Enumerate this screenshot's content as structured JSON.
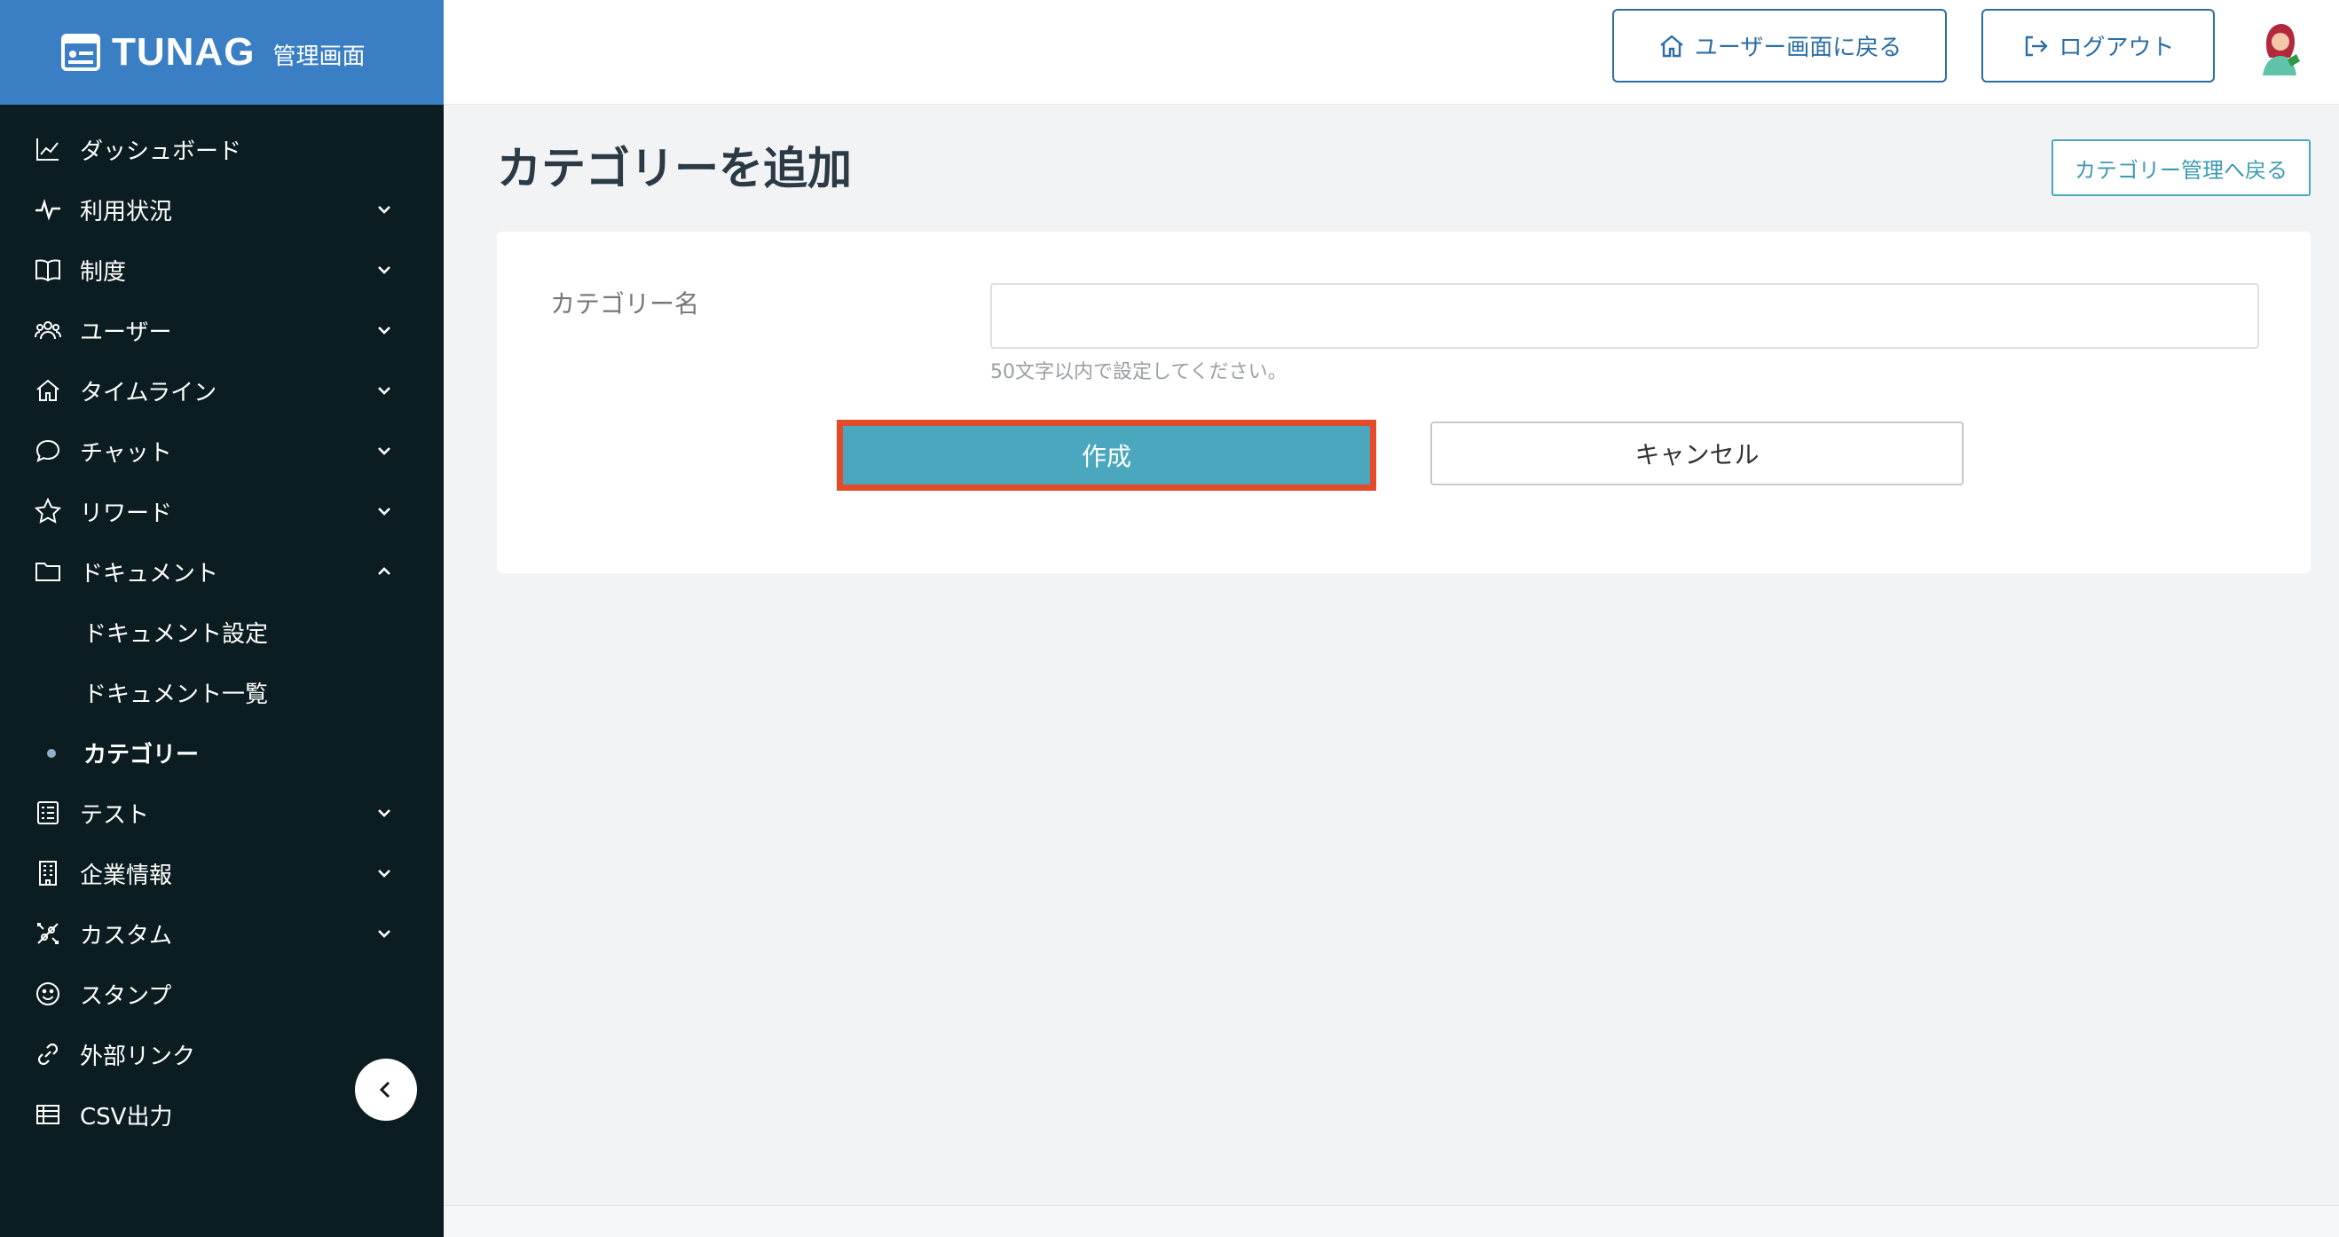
{
  "brand": {
    "name": "TUNAG",
    "sub": "管理画面"
  },
  "header": {
    "user_screen_label": "ユーザー画面に戻る",
    "logout_label": "ログアウト"
  },
  "sidebar": {
    "items": [
      {
        "label": "ダッシュボード",
        "icon": "chart-line-icon",
        "expandable": false
      },
      {
        "label": "利用状況",
        "icon": "activity-icon",
        "expandable": true
      },
      {
        "label": "制度",
        "icon": "book-icon",
        "expandable": true
      },
      {
        "label": "ユーザー",
        "icon": "users-icon",
        "expandable": true
      },
      {
        "label": "タイムライン",
        "icon": "home-icon",
        "expandable": true
      },
      {
        "label": "チャット",
        "icon": "chat-bubble-icon",
        "expandable": true
      },
      {
        "label": "リワード",
        "icon": "star-icon",
        "expandable": true
      },
      {
        "label": "ドキュメント",
        "icon": "folder-icon",
        "expandable": true,
        "expanded": true
      },
      {
        "label": "テスト",
        "icon": "checklist-icon",
        "expandable": true
      },
      {
        "label": "企業情報",
        "icon": "building-icon",
        "expandable": true
      },
      {
        "label": "カスタム",
        "icon": "tools-icon",
        "expandable": true
      },
      {
        "label": "スタンプ",
        "icon": "smile-icon",
        "expandable": false
      },
      {
        "label": "外部リンク",
        "icon": "link-icon",
        "expandable": false
      },
      {
        "label": "CSV出力",
        "icon": "table-icon",
        "expandable": false
      }
    ],
    "document_subitems": [
      {
        "label": "ドキュメント設定",
        "active": false
      },
      {
        "label": "ドキュメント一覧",
        "active": false
      },
      {
        "label": "カテゴリー",
        "active": true
      }
    ]
  },
  "main": {
    "title": "カテゴリーを追加",
    "back_label": "カテゴリー管理へ戻る",
    "form": {
      "name_label": "カテゴリー名",
      "name_value": "",
      "name_placeholder": "",
      "help_text": "50文字以内で設定してください。",
      "create_label": "作成",
      "cancel_label": "キャンセル"
    }
  },
  "colors": {
    "sidebar_bg": "#0c1d22",
    "brand_bg": "#3a7fc4",
    "primary": "#4aa7be",
    "header_button": "#2a6ea3",
    "highlight": "#e44b2a"
  }
}
